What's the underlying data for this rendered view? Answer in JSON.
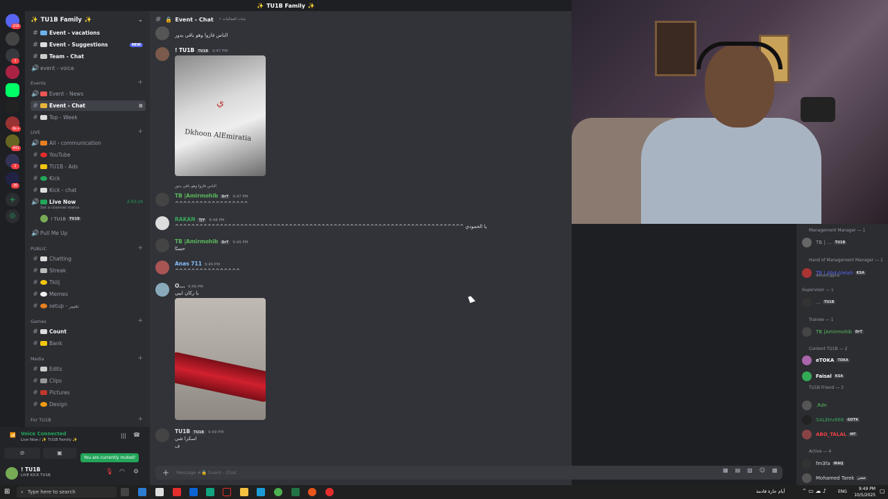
{
  "window": {
    "title": "TU1B Family"
  },
  "server": {
    "name": "TU1B Family",
    "badge": "208"
  },
  "rail_badges": [
    "208",
    "1",
    "6k+",
    "443",
    "1",
    "36"
  ],
  "channels": {
    "top": [
      {
        "label": "Event - vacations",
        "unread": true
      },
      {
        "label": "Event - Suggestions",
        "unread": true,
        "new": "NEW"
      },
      {
        "label": "Team - Chat",
        "unread": true
      },
      {
        "label": "event - voice",
        "unread": false
      }
    ],
    "events_category": "Events",
    "events": [
      {
        "label": "Event - News"
      },
      {
        "label": "Event - Chat",
        "selected": true
      },
      {
        "label": "Top - Week"
      }
    ],
    "live_category": "LIVE",
    "live": [
      {
        "label": "All - communication"
      },
      {
        "label": "YouTube"
      },
      {
        "label": "TU1B - Ads"
      },
      {
        "label": "Kick"
      },
      {
        "label": "Kick - chat"
      }
    ],
    "live_now": {
      "label": "Live Now",
      "timer": "2:03:24",
      "status": "Set a channel status",
      "user": "! TU1B",
      "user_tag": "TU1B"
    },
    "pull_me_up": "Pull Me Up",
    "public_category": "PUBLIC",
    "public": [
      {
        "label": "Chatting"
      },
      {
        "label": "Streak"
      },
      {
        "label": "Tklij"
      },
      {
        "label": "Memes"
      },
      {
        "label": "setup - تغيير"
      }
    ],
    "games_category": "Games",
    "games": [
      {
        "label": "Count",
        "unread": true
      },
      {
        "label": "Bank"
      }
    ],
    "media_category": "Media",
    "media": [
      {
        "label": "Edits"
      },
      {
        "label": "Clips"
      },
      {
        "label": "Pictures"
      },
      {
        "label": "Design"
      }
    ],
    "for_category": "For TU1B"
  },
  "voice": {
    "status": "Voice Connected",
    "location": "Live Now / ✨ TU1B Family ✨"
  },
  "toast": "You are currently muted!",
  "user": {
    "name": "! TU1B",
    "status": "LIVE KICK TU1B"
  },
  "chat": {
    "header": "Event - Chat",
    "header_sub": "• شات الفعاليات",
    "composer_placeholder": "Message #🔒 Event - Chat",
    "messages": [
      {
        "text_only": "الناس فازوا وهو باقي يدور",
        "time": "9:46 PM"
      },
      {
        "author": "! TU1B",
        "tag": "TU1B",
        "time": "9:47 PM",
        "image_text": "Dkhoon AlEmiratia",
        "color": "#ffffff"
      },
      {
        "reply": "الناس فازوا وهو باقي يدور",
        "author": "TB |Amirmohib",
        "tag": "DrT",
        "time": "9:47 PM",
        "text": "^^^^^^^^^^^^^^^^^^",
        "color": "#5cb85c"
      },
      {
        "author": "RAKAN",
        "tag": "TJY",
        "time": "9:48 PM",
        "text": "^^^^^^^^^^^^^^^^^^^^^^^^^^^^^^^^^^^^^^^^^^^^^^^^^^^^^^^^^^^^^^^^^^^^^^^ يا الحمودي",
        "color": "#3ba55d"
      },
      {
        "author": "TB |Amirmohib",
        "tag": "DrT",
        "time": "9:49 PM",
        "text": "حسنًا",
        "color": "#5cb85c"
      },
      {
        "author": "Anas 711",
        "time": "9:49 PM",
        "text": "^^^^^^^^^^^^^^^^",
        "color": "#8ac0ff"
      },
      {
        "author": "O...",
        "time": "9:49 PM",
        "text": "يا ركان ابيي",
        "color": "#dbdee1"
      },
      {
        "author": "TU1B",
        "tag": "TU1B",
        "time": "9:49 PM",
        "text": "اسكرا شي",
        "text2": "ف",
        "color": "#dbdee1"
      }
    ]
  },
  "members": {
    "categories": [
      {
        "label": "Management Manager — 1",
        "members": [
          {
            "name": "TB | ...",
            "tag": "TU1B",
            "sub": "...",
            "color": "#949ba4"
          }
        ]
      },
      {
        "label": "Hand of Management Manager — 1",
        "members": [
          {
            "name": "TB | Abd-Alelah",
            "tag": "KSA",
            "sub": "discord.gg/cls",
            "color": "#5865f2"
          }
        ]
      },
      {
        "label": "Supervisor — 1",
        "members": [
          {
            "name": "...",
            "tag": "TU1B",
            "sub": "In voice",
            "color": "#949ba4"
          }
        ]
      },
      {
        "label": "Trainee — 1",
        "members": [
          {
            "name": "TB |Amirmohib",
            "tag": "DrT",
            "color": "#5cb85c"
          }
        ]
      },
      {
        "label": "Content TU1B — 2",
        "members": [
          {
            "name": "eTOKA",
            "tag": "TOKA",
            "sub": "Kick eTOKA",
            "color": "#ffffff"
          },
          {
            "name": "Faisal",
            "tag": "KSA",
            "color": "#ffffff"
          }
        ]
      },
      {
        "label": "TU1B Friend — 3",
        "members": [
          {
            "name": ".Rdn",
            "color": "#5cb85c"
          },
          {
            "name": "SALEHv666",
            "tag": "GOTK",
            "color": "#3ba55d"
          },
          {
            "name": "ABO_TALAL",
            "tag": "MT",
            "color": "#ed4245"
          }
        ]
      },
      {
        "label": "Active — 4",
        "members": [
          {
            "name": "fm3fa",
            "tag": "IRAQ",
            "color": "#dbdee1"
          },
          {
            "name": "Mohamed Tarek",
            "tag": "عشر",
            "color": "#dbdee1"
          }
        ]
      }
    ]
  },
  "taskbar": {
    "search_placeholder": "Type here to search",
    "weather": "أيام حارة قادمة",
    "lang": "ENG",
    "time": "9:49 PM",
    "date": "10/5/2025"
  }
}
